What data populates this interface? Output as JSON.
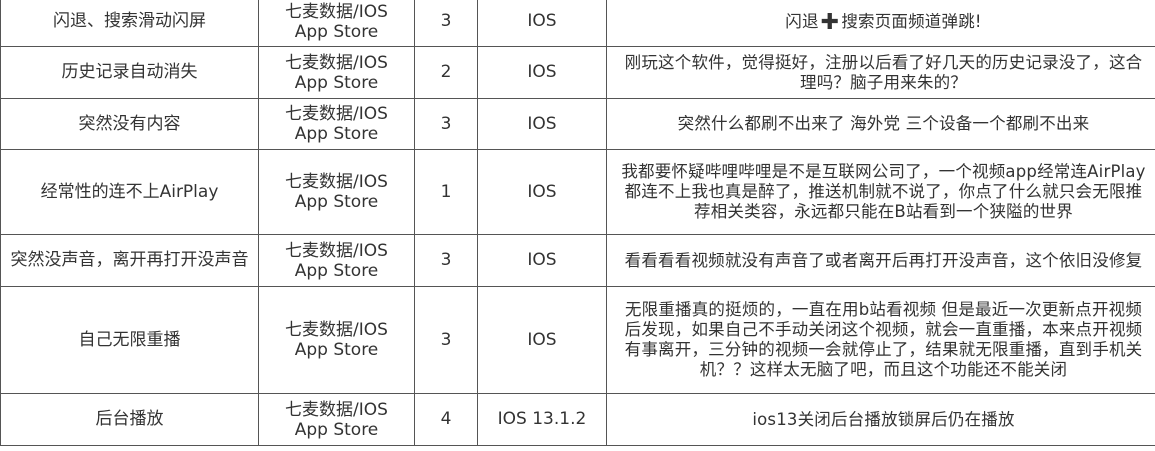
{
  "rows": [
    {
      "issue": "闪退、搜索滑动闪屏",
      "source_line1": "七麦数据/IOS",
      "source_line2": "App Store",
      "rating": "3",
      "platform": "IOS",
      "desc_before": "闪退",
      "desc_after": "搜索页面频道弹跳!"
    },
    {
      "issue": "历史记录自动消失",
      "source_line1": "七麦数据/IOS",
      "source_line2": "App Store",
      "rating": "2",
      "platform": "IOS",
      "description": "刚玩这个软件，觉得挺好，注册以后看了好几天的历史记录没了，这合理吗？脑子用来朱的？"
    },
    {
      "issue": "突然没有内容",
      "source_line1": "七麦数据/IOS",
      "source_line2": "App Store",
      "rating": "3",
      "platform": "IOS",
      "description": "突然什么都刷不出来了 海外党 三个设备一个都刷不出来"
    },
    {
      "issue": "经常性的连不上AirPlay",
      "source_line1": "七麦数据/IOS",
      "source_line2": "App Store",
      "rating": "1",
      "platform": "IOS",
      "description": "我都要怀疑哔哩哔哩是不是互联网公司了，一个视频app经常连AirPlay都连不上我也真是醉了，推送机制就不说了，你点了什么就只会无限推荐相关类容，永远都只能在B站看到一个狭隘的世界"
    },
    {
      "issue": "突然没声音，离开再打开没声音",
      "source_line1": "七麦数据/IOS",
      "source_line2": "App Store",
      "rating": "3",
      "platform": "IOS",
      "description": "看看看看视频就没有声音了或者离开后再打开没声音，这个依旧没修复"
    },
    {
      "issue": "自己无限重播",
      "source_line1": "七麦数据/IOS",
      "source_line2": "App Store",
      "rating": "3",
      "platform": "IOS",
      "description": "无限重播真的挺烦的，一直在用b站看视频 但是最近一次更新点开视频后发现，如果自己不手动关闭这个视频，就会一直重播，本来点开视频有事离开，三分钟的视频一会就停止了，结果就无限重播，直到手机关机？？这样太无脑了吧，而且这个功能还不能关闭"
    },
    {
      "issue": "后台播放",
      "source_line1": "七麦数据/IOS",
      "source_line2": "App Store",
      "rating": "4",
      "platform": "IOS 13.1.2",
      "description": "ios13关闭后台播放锁屏后仍在播放"
    }
  ],
  "icons": {
    "plus_icon": "plus-icon"
  }
}
